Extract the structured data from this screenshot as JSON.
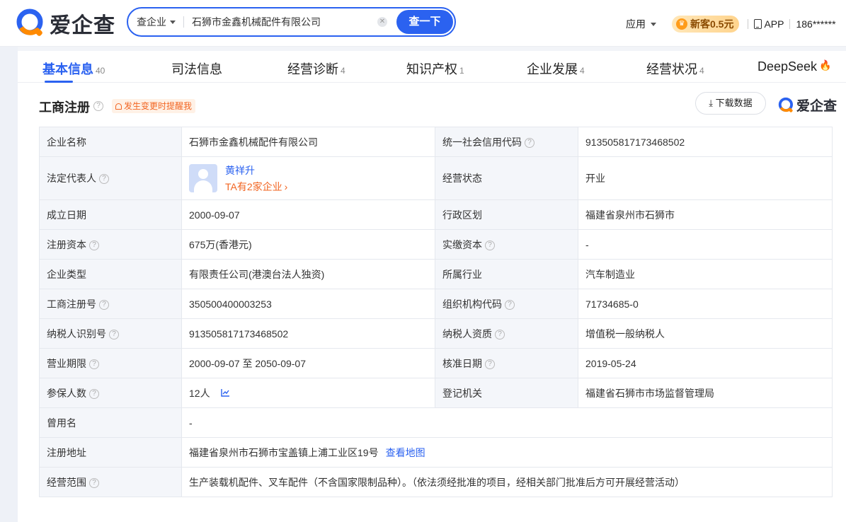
{
  "header": {
    "logo_text": "爱企查",
    "search_type": "查企业",
    "search_value": "石狮市金鑫机械配件有限公司",
    "search_button": "查一下",
    "apps_label": "应用",
    "vip_label": "新客0.5元",
    "app_label": "APP",
    "user_phone": "186******"
  },
  "tabs": [
    {
      "label": "基本信息",
      "count": "40"
    },
    {
      "label": "司法信息",
      "count": ""
    },
    {
      "label": "经营诊断",
      "count": "4"
    },
    {
      "label": "知识产权",
      "count": "1"
    },
    {
      "label": "企业发展",
      "count": "4"
    },
    {
      "label": "经营状况",
      "count": "4"
    },
    {
      "label": "DeepSeek",
      "count": ""
    }
  ],
  "section": {
    "title": "工商注册",
    "remind_label": "发生变更时提醒我",
    "download_label": "下载数据",
    "brand_label": "爱企查"
  },
  "registry": {
    "company_name_label": "企业名称",
    "company_name": "石狮市金鑫机械配件有限公司",
    "credit_code_label": "统一社会信用代码",
    "credit_code": "913505817173468502",
    "legal_rep_label": "法定代表人",
    "legal_rep_name": "黄祥升",
    "legal_rep_sub": "TA有2家企业",
    "status_label": "经营状态",
    "status": "开业",
    "found_date_label": "成立日期",
    "found_date": "2000-09-07",
    "region_label": "行政区划",
    "region": "福建省泉州市石狮市",
    "reg_capital_label": "注册资本",
    "reg_capital": "675万(香港元)",
    "paid_capital_label": "实缴资本",
    "paid_capital": "-",
    "type_label": "企业类型",
    "type": "有限责任公司(港澳台法人独资)",
    "industry_label": "所属行业",
    "industry": "汽车制造业",
    "reg_no_label": "工商注册号",
    "reg_no": "350500400003253",
    "org_code_label": "组织机构代码",
    "org_code": "71734685-0",
    "tax_id_label": "纳税人识别号",
    "tax_id": "913505817173468502",
    "tax_qual_label": "纳税人资质",
    "tax_qual": "增值税一般纳税人",
    "term_label": "营业期限",
    "term": "2000-09-07 至 2050-09-07",
    "approve_date_label": "核准日期",
    "approve_date": "2019-05-24",
    "insured_label": "参保人数",
    "insured": "12人",
    "authority_label": "登记机关",
    "authority": "福建省石狮市市场监督管理局",
    "former_name_label": "曾用名",
    "former_name": "-",
    "address_label": "注册地址",
    "address": "福建省泉州市石狮市宝盖镇上浦工业区19号",
    "map_link": "查看地图",
    "scope_label": "经营范围",
    "scope": "生产装载机配件、叉车配件（不含国家限制品种）。（依法须经批准的项目，经相关部门批准后方可开展经营活动）"
  }
}
